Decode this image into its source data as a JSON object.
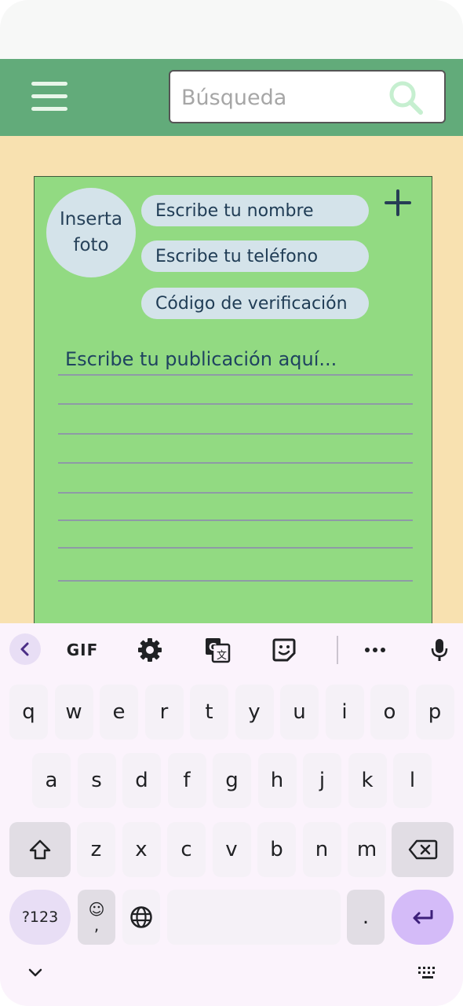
{
  "header": {
    "search_placeholder": "Búsqueda"
  },
  "card": {
    "photo_label": "Inserta foto",
    "name_placeholder": "Escribe tu nombre",
    "phone_placeholder": "Escribe tu teléfono",
    "code_placeholder": "Código de verificación",
    "post_placeholder": "Escribe tu publicación aquí..."
  },
  "keyboard": {
    "toolbar": {
      "gif_label": "GIF"
    },
    "rows": [
      [
        "q",
        "w",
        "e",
        "r",
        "t",
        "y",
        "u",
        "i",
        "o",
        "p"
      ],
      [
        "a",
        "s",
        "d",
        "f",
        "g",
        "h",
        "j",
        "k",
        "l"
      ],
      [
        "z",
        "x",
        "c",
        "v",
        "b",
        "n",
        "m"
      ]
    ],
    "symbols_label": "?123",
    "emoji_label": "☺",
    "comma_label": ",",
    "period_label": "."
  },
  "colors": {
    "header_bg": "#62ab7a",
    "content_bg": "#f8e1b0",
    "card_bg": "#92da82",
    "pill_bg": "#d4e3ea",
    "keyboard_bg": "#fbf3fc",
    "enter_bg": "#d4bbf8"
  }
}
